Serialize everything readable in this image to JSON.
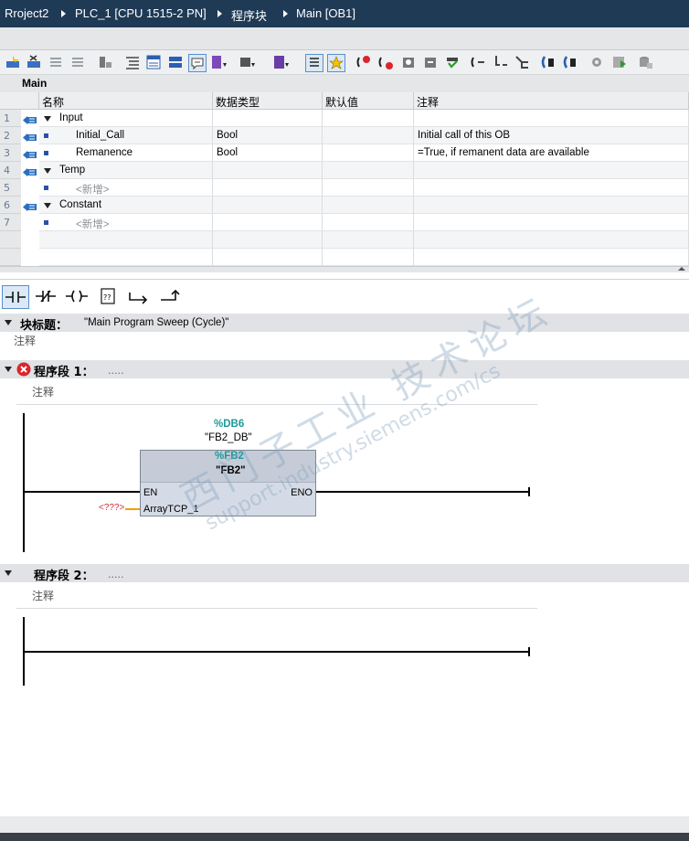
{
  "breadcrumb": [
    "Rroject2",
    "PLC_1 [CPU 1515-2 PN]",
    "程序块",
    "Main [OB1]"
  ],
  "toolbar": {
    "icons": [
      "insert-row-icon",
      "delete-row-icon",
      "shift-right-icon",
      "shift-left-icon",
      "clear-icon",
      "expand-all-icon",
      "collapse-all-icon",
      "network-view-icon",
      "comment-toggle-icon",
      "go-to-absolute-icon",
      "favorites-icon",
      "call-icon",
      "monitor-icon",
      "breakpoint-icon",
      "online-icon",
      "list-icon",
      "compare-icon",
      "download-icon"
    ]
  },
  "block": {
    "name": "Main"
  },
  "interface": {
    "columns": [
      "名称",
      "数据类型",
      "默认值",
      "注释"
    ],
    "rows": [
      {
        "num": "1",
        "name": "Input",
        "type": "",
        "default": "",
        "comment": "",
        "kind": "section"
      },
      {
        "num": "2",
        "name": "Initial_Call",
        "type": "Bool",
        "default": "",
        "comment": "Initial call of this OB",
        "kind": "var"
      },
      {
        "num": "3",
        "name": "Remanence",
        "type": "Bool",
        "default": "",
        "comment": "=True, if remanent data are available",
        "kind": "var"
      },
      {
        "num": "4",
        "name": "Temp",
        "type": "",
        "default": "",
        "comment": "",
        "kind": "section"
      },
      {
        "num": "5",
        "name": "<新增>",
        "type": "",
        "default": "",
        "comment": "",
        "kind": "add"
      },
      {
        "num": "6",
        "name": "Constant",
        "type": "",
        "default": "",
        "comment": "",
        "kind": "section"
      },
      {
        "num": "7",
        "name": "<新增>",
        "type": "",
        "default": "",
        "comment": "",
        "kind": "add"
      }
    ]
  },
  "palette": [
    "contact-no-icon",
    "contact-nc-icon",
    "coil-icon",
    "empty-box-icon",
    "open-branch-icon",
    "close-branch-icon"
  ],
  "block_title": {
    "label": "块标题：",
    "value": "\"Main Program Sweep (Cycle)\"",
    "comment": "注释"
  },
  "networks": [
    {
      "title": "程序段 1：",
      "dots": ".....",
      "comment": "注释",
      "has_error": true,
      "fb": {
        "db_addr": "%DB6",
        "db_name": "\"FB2_DB\"",
        "fb_addr": "%FB2",
        "fb_name": "\"FB2\"",
        "pin_en": "EN",
        "pin_eno": "ENO",
        "pin_in": "ArrayTCP_1",
        "param": "<???>"
      }
    },
    {
      "title": "程序段 2：",
      "dots": ".....",
      "comment": "注释",
      "has_error": false
    }
  ],
  "watermark": {
    "line1": "西门子工业 技术论坛",
    "line2": "support.industry.siemens.com/cs"
  },
  "colors": {
    "titlebar": "#1f3a55",
    "teal": "#1c9a9a",
    "error": "#d9262b",
    "param_red": "#d0303a",
    "orange": "#f0a000"
  }
}
